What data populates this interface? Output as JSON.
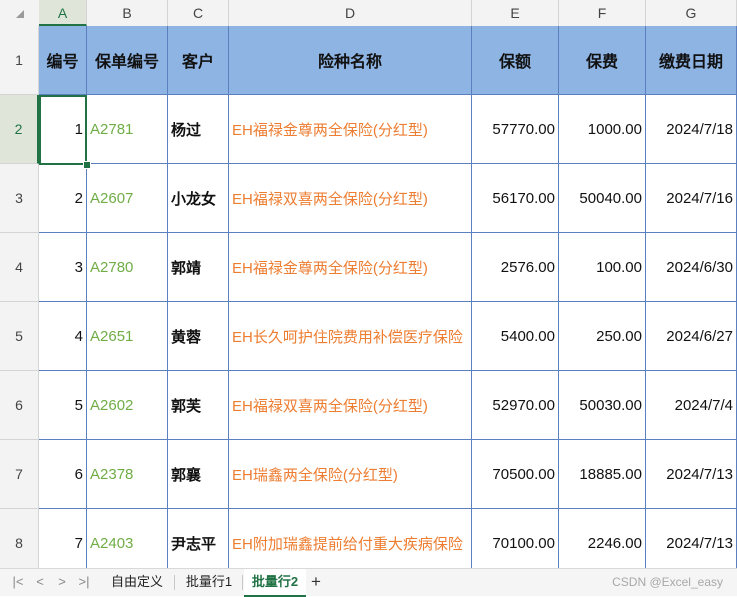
{
  "columns": [
    "A",
    "B",
    "C",
    "D",
    "E",
    "F",
    "G"
  ],
  "row_numbers": [
    "1",
    "2",
    "3",
    "4",
    "5",
    "6",
    "7",
    "8"
  ],
  "header": [
    "编号",
    "保单编号",
    "客户",
    "险种名称",
    "保额",
    "保费",
    "缴费日期"
  ],
  "rows": [
    {
      "id": "1",
      "policy": "A2781",
      "customer": "杨过",
      "insurance": "EH福禄金尊两全保险(分红型)",
      "amount": "57770.00",
      "premium": "1000.00",
      "date": "2024/7/18"
    },
    {
      "id": "2",
      "policy": "A2607",
      "customer": "小龙女",
      "insurance": "EH福禄双喜两全保险(分红型)",
      "amount": "56170.00",
      "premium": "50040.00",
      "date": "2024/7/16"
    },
    {
      "id": "3",
      "policy": "A2780",
      "customer": "郭靖",
      "insurance": "EH福禄金尊两全保险(分红型)",
      "amount": "2576.00",
      "premium": "100.00",
      "date": "2024/6/30"
    },
    {
      "id": "4",
      "policy": "A2651",
      "customer": "黄蓉",
      "insurance": "EH长久呵护住院费用补偿医疗保险",
      "amount": "5400.00",
      "premium": "250.00",
      "date": "2024/6/27"
    },
    {
      "id": "5",
      "policy": "A2602",
      "customer": "郭芙",
      "insurance": "EH福禄双喜两全保险(分红型)",
      "amount": "52970.00",
      "premium": "50030.00",
      "date": "2024/7/4"
    },
    {
      "id": "6",
      "policy": "A2378",
      "customer": "郭襄",
      "insurance": "EH瑞鑫两全保险(分红型)",
      "amount": "70500.00",
      "premium": "18885.00",
      "date": "2024/7/13"
    },
    {
      "id": "7",
      "policy": "A2403",
      "customer": "尹志平",
      "insurance": "EH附加瑞鑫提前给付重大疾病保险",
      "amount": "70100.00",
      "premium": "2246.00",
      "date": "2024/7/13"
    }
  ],
  "tabs": [
    "自由定义",
    "批量行1",
    "批量行2"
  ],
  "active_tab": "批量行2",
  "add_tab": "+",
  "nav": [
    "|<",
    "<",
    ">",
    ">|"
  ],
  "watermark": "CSDN @Excel_easy",
  "colors": {
    "header_fill": "#8eb4e3",
    "policy_text": "#70ad47",
    "insurance_text": "#ed7d31",
    "selection": "#217346"
  }
}
